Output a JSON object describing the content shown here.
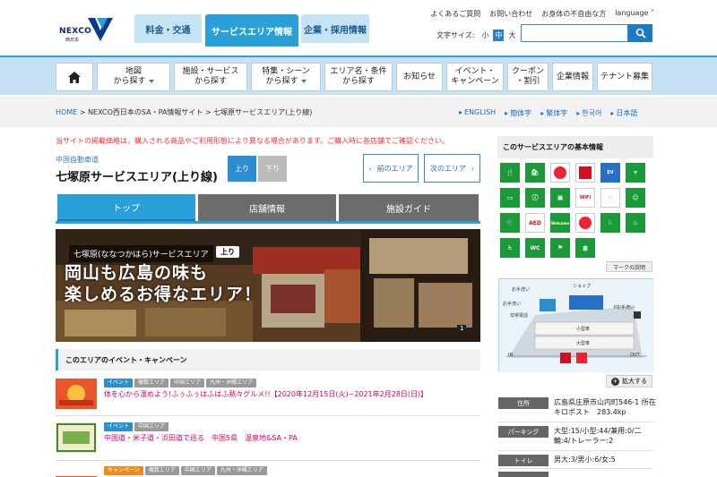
{
  "header": {
    "logo_text": "NEXCO",
    "logo_sub": "西日本",
    "tabs": [
      "料金・交通",
      "サービスエリア情報",
      "企業・採用情報"
    ],
    "top_links": [
      "よくあるご質問",
      "お問い合わせ",
      "お身体の不自由な方",
      "language"
    ],
    "font_size_label": "文字サイズ:",
    "font_sizes": [
      "小",
      "中",
      "大"
    ]
  },
  "nav": {
    "items": [
      {
        "l1": "地図",
        "l2": "から探す"
      },
      {
        "l1": "施設・サービス",
        "l2": "から探す"
      },
      {
        "l1": "特集・シーン",
        "l2": "から探す"
      },
      {
        "l1": "エリア名・条件",
        "l2": "から探す"
      },
      {
        "l1": "お知らせ",
        "l2": ""
      },
      {
        "l1": "イベント・",
        "l2": "キャンペーン"
      },
      {
        "l1": "クーポン",
        "l2": "・割引"
      },
      {
        "l1": "企業情報",
        "l2": ""
      },
      {
        "l1": "テナント募集",
        "l2": ""
      }
    ]
  },
  "breadcrumb": {
    "home": "HOME",
    "path": " > NEXCO西日本のSA・PA情報サイト > 七塚原サービスエリア(上り線)"
  },
  "languages": [
    "ENGLISH",
    "簡体字",
    "繁体字",
    "한국어",
    "日本語"
  ],
  "notice": "当サイトの掲載価格は，購入される商品やご利用形態により異なる場合があります。ご購入時に各店舗でご確認ください。",
  "area": {
    "road": "中国自動車道",
    "name": "七塚原サービスエリア(上り線)",
    "dir_up": "上り",
    "dir_down": "下り",
    "prev": "前のエリア",
    "next": "次のエリア"
  },
  "content_tabs": [
    "トップ",
    "店舗情報",
    "施設ガイド"
  ],
  "hero": {
    "label": "七塚原(ななつかはら)サービスエリア",
    "dir": "上り",
    "line1": "岡山も広島の味も",
    "line2": "楽しめるお得なエリア！",
    "page": "1"
  },
  "events": {
    "heading": "このエリアのイベント・キャンペーン",
    "items": [
      {
        "tags": [
          "イベント",
          "複数エリア",
          "中国エリア",
          "九州・沖縄エリア"
        ],
        "title": "体を心から温めよう!ふぅふぅはふはふ熱々グルメ!!【2020年12月15日(火)~2021年2月28日(日)】"
      },
      {
        "tags": [
          "イベント",
          "中国エリア"
        ],
        "title": "中国道・米子道・浜田道で巡る　中国5県　温泉地&SA・PA"
      },
      {
        "tags": [
          "キャンペーン",
          "複数エリア",
          "中国エリア",
          "九州・沖縄エリア"
        ],
        "title": ""
      }
    ]
  },
  "sidebar": {
    "heading": "このサービスエリアの基本情報",
    "mark_button": "マークの説明",
    "zoom_button": "拡大する",
    "map_labels": [
      "お手洗い",
      "ショップ",
      "お手洗い",
      "非常電話",
      "Pお手洗い",
      "小型車",
      "大型車",
      "IN",
      "OUT"
    ],
    "info": [
      {
        "label": "住所",
        "value": "広島県庄原市山内町546-1 所在キロポスト　283.4kp"
      },
      {
        "label": "パーキング",
        "value": "大型:15/小型:44/兼用:0/二輪:4/トレーラー:2"
      },
      {
        "label": "トイレ",
        "value": "男大:3/男小:6/女:5"
      },
      {
        "label": "",
        "value": ""
      }
    ]
  },
  "colors": {
    "accent": "#2aa0d8",
    "nav_bg": "#c4e2f4",
    "red": "#e33",
    "green": "#1c9a3a"
  }
}
